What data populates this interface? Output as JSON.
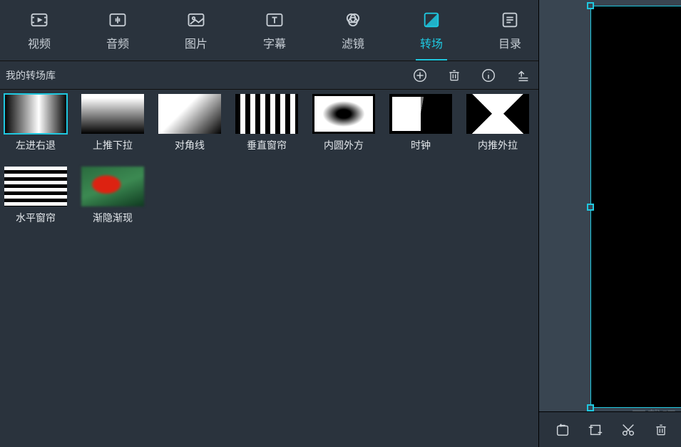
{
  "tabs": [
    {
      "id": "video",
      "label": "视频"
    },
    {
      "id": "audio",
      "label": "音频"
    },
    {
      "id": "image",
      "label": "图片"
    },
    {
      "id": "subtitle",
      "label": "字幕"
    },
    {
      "id": "filter",
      "label": "滤镜"
    },
    {
      "id": "transition",
      "label": "转场"
    },
    {
      "id": "catalog",
      "label": "目录"
    }
  ],
  "active_tab": "transition",
  "library": {
    "title": "我的转场库",
    "items": [
      {
        "id": "left-right",
        "label": "左进右退",
        "thumb_class": "gr-lr",
        "selected": true
      },
      {
        "id": "push-up-down",
        "label": "上推下拉",
        "thumb_class": "gr-tb",
        "selected": false
      },
      {
        "id": "diagonal",
        "label": "对角线",
        "thumb_class": "gr-diag",
        "selected": false
      },
      {
        "id": "vertical-curtain",
        "label": "垂直窗帘",
        "thumb_class": "gr-vbars",
        "selected": false
      },
      {
        "id": "inner-circle-outer-square",
        "label": "内圆外方",
        "thumb_class": "gr-radial",
        "selected": false
      },
      {
        "id": "clock",
        "label": "时钟",
        "thumb_class": "gr-clock",
        "selected": false
      },
      {
        "id": "inner-push-outer-pull",
        "label": "内推外拉",
        "thumb_class": "gr-inout",
        "selected": false
      },
      {
        "id": "horizontal-curtain",
        "label": "水平窗帘",
        "thumb_class": "gr-hbars",
        "selected": false
      },
      {
        "id": "fade",
        "label": "渐隐渐现",
        "thumb_class": "gr-fade",
        "selected": false
      }
    ]
  },
  "watermark": "下载吧"
}
